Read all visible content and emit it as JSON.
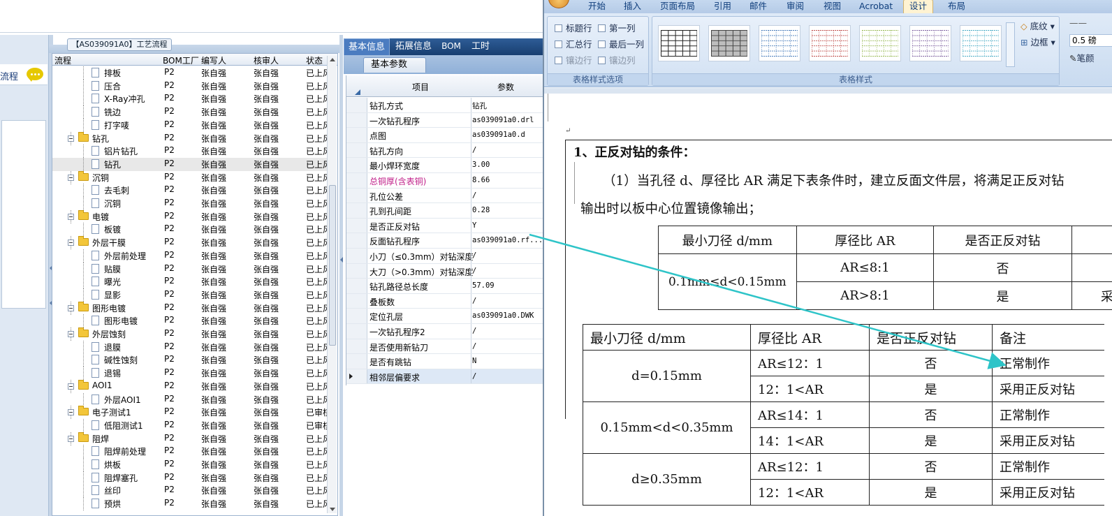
{
  "left": {
    "nav_label": "流程",
    "process_title": "【AS039091A0】工艺流程",
    "tree_columns": [
      "流程",
      "BOM工厂",
      "编写人",
      "核审人",
      "状态"
    ],
    "tree_rows": [
      {
        "name": "排板",
        "level": 2,
        "bom": "P2",
        "author": "张自强",
        "reviewer": "张自强",
        "status": "已上风"
      },
      {
        "name": "压合",
        "level": 2,
        "bom": "P2",
        "author": "张自强",
        "reviewer": "张自强",
        "status": "已上风"
      },
      {
        "name": "X-Ray冲孔",
        "level": 2,
        "bom": "P2",
        "author": "张自强",
        "reviewer": "张自强",
        "status": "已上风"
      },
      {
        "name": "铣边",
        "level": 2,
        "bom": "P2",
        "author": "张自强",
        "reviewer": "张自强",
        "status": "已上风"
      },
      {
        "name": "打字唛",
        "level": 2,
        "bom": "P2",
        "author": "张自强",
        "reviewer": "张自强",
        "status": "已上风"
      },
      {
        "name": "钻孔",
        "level": 1,
        "bom": "P2",
        "author": "张自强",
        "reviewer": "张自强",
        "status": "已上风"
      },
      {
        "name": "铝片钻孔",
        "level": 2,
        "bom": "P2",
        "author": "张自强",
        "reviewer": "张自强",
        "status": "已上风"
      },
      {
        "name": "钻孔",
        "level": 2,
        "bom": "P2",
        "author": "张自强",
        "reviewer": "张自强",
        "status": "已上风",
        "selected": true
      },
      {
        "name": "沉铜",
        "level": 1,
        "bom": "P2",
        "author": "张自强",
        "reviewer": "张自强",
        "status": "已上风"
      },
      {
        "name": "去毛刺",
        "level": 2,
        "bom": "P2",
        "author": "张自强",
        "reviewer": "张自强",
        "status": "已上风"
      },
      {
        "name": "沉铜",
        "level": 2,
        "bom": "P2",
        "author": "张自强",
        "reviewer": "张自强",
        "status": "已上风"
      },
      {
        "name": "电镀",
        "level": 1,
        "bom": "P2",
        "author": "张自强",
        "reviewer": "张自强",
        "status": "已上风"
      },
      {
        "name": "板镀",
        "level": 2,
        "bom": "P2",
        "author": "张自强",
        "reviewer": "张自强",
        "status": "已上风"
      },
      {
        "name": "外层干膜",
        "level": 1,
        "bom": "P2",
        "author": "张自强",
        "reviewer": "张自强",
        "status": "已上风"
      },
      {
        "name": "外层前处理",
        "level": 2,
        "bom": "P2",
        "author": "张自强",
        "reviewer": "张自强",
        "status": "已上风"
      },
      {
        "name": "贴膜",
        "level": 2,
        "bom": "P2",
        "author": "张自强",
        "reviewer": "张自强",
        "status": "已上风"
      },
      {
        "name": "曝光",
        "level": 2,
        "bom": "P2",
        "author": "张自强",
        "reviewer": "张自强",
        "status": "已上风"
      },
      {
        "name": "显影",
        "level": 2,
        "bom": "P2",
        "author": "张自强",
        "reviewer": "张自强",
        "status": "已上风"
      },
      {
        "name": "图形电镀",
        "level": 1,
        "bom": "P2",
        "author": "张自强",
        "reviewer": "张自强",
        "status": "已上风"
      },
      {
        "name": "图形电镀",
        "level": 2,
        "bom": "P2",
        "author": "张自强",
        "reviewer": "张自强",
        "status": "已上风"
      },
      {
        "name": "外层蚀刻",
        "level": 1,
        "bom": "P2",
        "author": "张自强",
        "reviewer": "张自强",
        "status": "已上风"
      },
      {
        "name": "退膜",
        "level": 2,
        "bom": "P2",
        "author": "张自强",
        "reviewer": "张自强",
        "status": "已上风"
      },
      {
        "name": "碱性蚀刻",
        "level": 2,
        "bom": "P2",
        "author": "张自强",
        "reviewer": "张自强",
        "status": "已上风"
      },
      {
        "name": "退锡",
        "level": 2,
        "bom": "P2",
        "author": "张自强",
        "reviewer": "张自强",
        "status": "已上风"
      },
      {
        "name": "AOI1",
        "level": 1,
        "bom": "P2",
        "author": "张自强",
        "reviewer": "张自强",
        "status": "已上风"
      },
      {
        "name": "外层AOI1",
        "level": 2,
        "bom": "P2",
        "author": "张自强",
        "reviewer": "张自强",
        "status": "已上风"
      },
      {
        "name": "电子测试1",
        "level": 1,
        "bom": "P2",
        "author": "张自强",
        "reviewer": "张自强",
        "status": "已审核"
      },
      {
        "name": "低阻测试1",
        "level": 2,
        "bom": "P2",
        "author": "张自强",
        "reviewer": "张自强",
        "status": "已审核"
      },
      {
        "name": "阻焊",
        "level": 1,
        "bom": "P2",
        "author": "张自强",
        "reviewer": "张自强",
        "status": "已上风"
      },
      {
        "name": "阻焊前处理",
        "level": 2,
        "bom": "P2",
        "author": "张自强",
        "reviewer": "张自强",
        "status": "已上风"
      },
      {
        "name": "烘板",
        "level": 2,
        "bom": "P2",
        "author": "张自强",
        "reviewer": "张自强",
        "status": "已上风"
      },
      {
        "name": "阻焊塞孔",
        "level": 2,
        "bom": "P2",
        "author": "张自强",
        "reviewer": "张自强",
        "status": "已上风"
      },
      {
        "name": "丝印",
        "level": 2,
        "bom": "P2",
        "author": "张自强",
        "reviewer": "张自强",
        "status": "已上风"
      },
      {
        "name": "预烘",
        "level": 2,
        "bom": "P2",
        "author": "张自强",
        "reviewer": "张自强",
        "status": "已上风"
      }
    ]
  },
  "params": {
    "tabs": [
      "基本信息",
      "拓展信息",
      "BOM",
      "工时"
    ],
    "active_tab": "基本信息",
    "sub_tab": "基本参数",
    "col_item": "项目",
    "col_param": "参数",
    "rows": [
      {
        "name": "钻孔方式",
        "value": "钻孔"
      },
      {
        "name": "一次钻孔程序",
        "value": "as039091a0.drl"
      },
      {
        "name": "点图",
        "value": "as039091a0.d"
      },
      {
        "name": "钻孔方向",
        "value": "/"
      },
      {
        "name": "最小焊环宽度",
        "value": "3.00"
      },
      {
        "name": "总铜厚(含表铜)",
        "value": "8.66",
        "highlight": true
      },
      {
        "name": "孔位公差",
        "value": "/"
      },
      {
        "name": "孔到孔间距",
        "value": "0.28"
      },
      {
        "name": "是否正反对钻",
        "value": "Y"
      },
      {
        "name": "反面钻孔程序",
        "value": "as039091a0.rf..."
      },
      {
        "name": "小刀（≤0.3mm）对钻深度",
        "value": "/"
      },
      {
        "name": "大刀（>0.3mm）对钻深度",
        "value": "/"
      },
      {
        "name": "钻孔路径总长度",
        "value": "57.09"
      },
      {
        "name": "叠板数",
        "value": "/"
      },
      {
        "name": "定位孔层",
        "value": "as039091a0.DWK"
      },
      {
        "name": "一次钻孔程序2",
        "value": "/"
      },
      {
        "name": "是否使用新钻刀",
        "value": "/"
      },
      {
        "name": "是否有跳钻",
        "value": "N"
      },
      {
        "name": "相邻层偏要求",
        "value": "/",
        "selected": true
      }
    ],
    "highlight_color": "#c0208a"
  },
  "word": {
    "tabs": [
      "开始",
      "插入",
      "页面布局",
      "引用",
      "邮件",
      "审阅",
      "视图",
      "Acrobat",
      "设计",
      "布局"
    ],
    "active_tab": "设计",
    "style_options": [
      "标题行",
      "第一列",
      "汇总行",
      "最后一列",
      "镶边行",
      "镶边列"
    ],
    "group_style_options": "表格样式选项",
    "group_table_styles": "表格样式",
    "shading": "底纹",
    "borders": "边框",
    "pt_value": "0.5 磅",
    "pen_color": "笔颜",
    "heading": "1、正反对钻的条件：",
    "para1": "（1）当孔径 d、厚径比 AR 满足下表条件时，建立反面文件层，将满足正反对钻",
    "para2": "输出时以板中心位置镜像输出；",
    "upper_table": {
      "headers": [
        "最小刀径 d/mm",
        "厚径比 AR",
        "是否正反对钻"
      ],
      "range": "0.1mm≤d<0.15mm",
      "rows": [
        [
          "AR≤8:1",
          "否"
        ],
        [
          "AR>8:1",
          "是"
        ]
      ],
      "cut_text": "采"
    },
    "lower_table": {
      "headers": [
        "最小刀径 d/mm",
        "厚径比 AR",
        "是否正反对钻",
        "备注"
      ],
      "groups": [
        {
          "range": "d=0.15mm",
          "rows": [
            [
              "AR≤12：1",
              "否",
              "正常制作"
            ],
            [
              "12：1<AR",
              "是",
              "采用正反对钻"
            ]
          ]
        },
        {
          "range": "0.15mm<d<0.35mm",
          "rows": [
            [
              "AR≤14：1",
              "否",
              "正常制作"
            ],
            [
              "14：1<AR",
              "是",
              "采用正反对钻"
            ]
          ]
        },
        {
          "range": "d≥0.35mm",
          "rows": [
            [
              "AR≤12：1",
              "否",
              "正常制作"
            ],
            [
              "12：1<AR",
              "是",
              "采用正反对钻"
            ]
          ]
        }
      ]
    },
    "arrow_color": "#2ec4c8"
  }
}
